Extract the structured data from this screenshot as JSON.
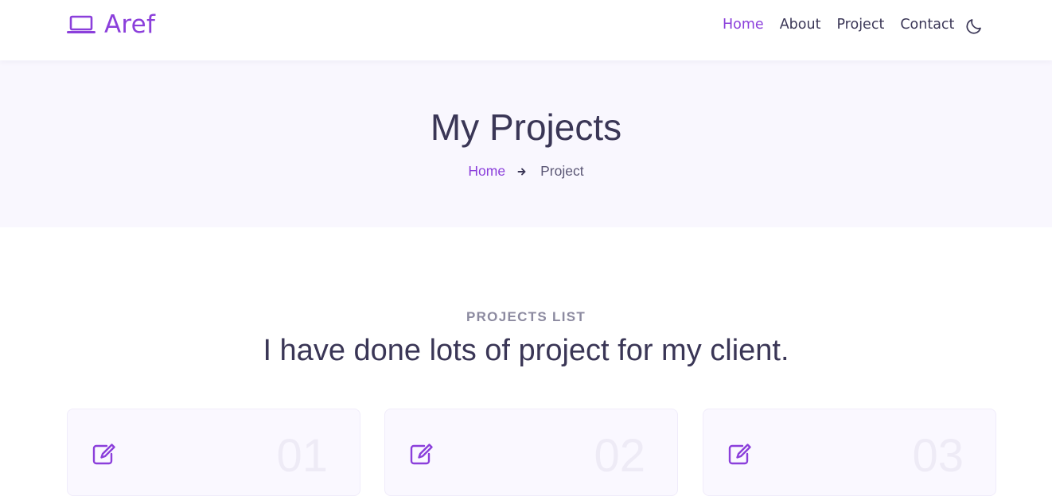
{
  "brand": {
    "name": "Aref",
    "icon": "laptop-icon",
    "color": "#8b3fdb"
  },
  "nav": {
    "items": [
      {
        "label": "Home",
        "active": true
      },
      {
        "label": "About",
        "active": false
      },
      {
        "label": "Project",
        "active": false
      },
      {
        "label": "Contact",
        "active": false
      }
    ],
    "theme_toggle_icon": "moon-icon"
  },
  "banner": {
    "title": "My Projects",
    "breadcrumb": {
      "home": "Home",
      "separator_icon": "arrow-right-icon",
      "current": "Project"
    }
  },
  "section": {
    "subtitle": "PROJECTS LIST",
    "title": "I have done lots of project for my client."
  },
  "projects": [
    {
      "number": "01",
      "icon": "edit-icon"
    },
    {
      "number": "02",
      "icon": "edit-icon"
    },
    {
      "number": "03",
      "icon": "edit-icon"
    }
  ],
  "colors": {
    "accent": "#8b3fdb",
    "text": "#3a3656",
    "banner_bg": "#f9f7fe",
    "card_bg": "#faf8ff"
  }
}
